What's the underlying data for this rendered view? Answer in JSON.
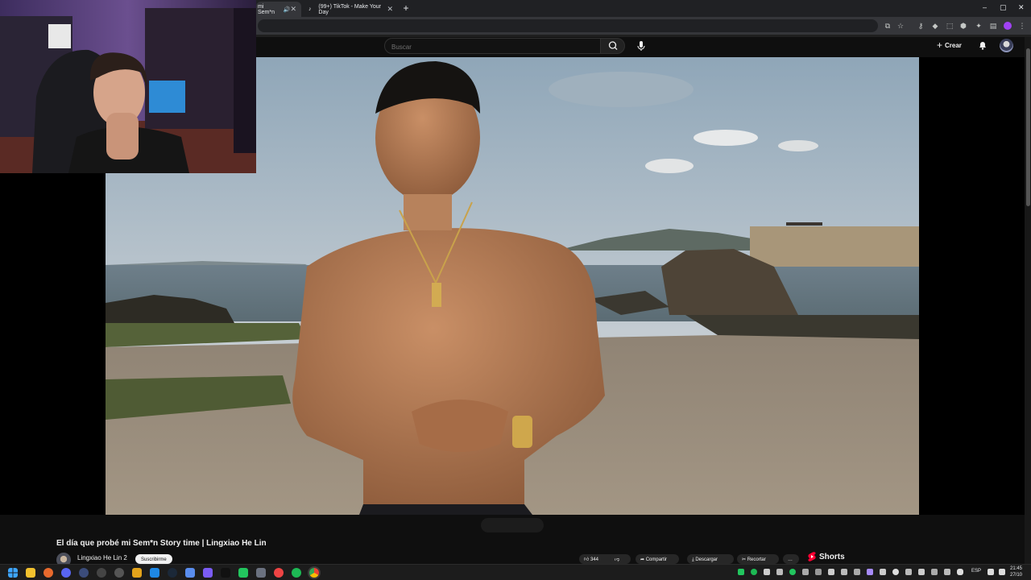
{
  "browser": {
    "tabs": [
      {
        "label": "mi Sem*n",
        "active": true
      },
      {
        "label": "(99+) TikTok - Make Your Day",
        "active": false
      }
    ],
    "new_tab_symbol": "+",
    "window_controls": [
      "–",
      "▢",
      "✕"
    ],
    "accent_extension_color": "#a142f4"
  },
  "youtube": {
    "search": {
      "placeholder": "Buscar",
      "value": ""
    },
    "create_label": "Crear",
    "video": {
      "title": "El día que probé mi Sem*n Story time | Lingxiao He Lin",
      "channel": "Lingxiao He Lin 2",
      "subscribe_label": "Suscribirme"
    },
    "actions": [
      {
        "label": "344",
        "icon": "like-icon"
      },
      {
        "label": "",
        "icon": "dislike-icon"
      },
      {
        "label": "Compartir",
        "icon": "share-icon"
      },
      {
        "label": "Descargar",
        "icon": "download-icon"
      },
      {
        "label": "Recortar",
        "icon": "clip-icon"
      },
      {
        "label": "…",
        "icon": "more-icon"
      }
    ],
    "shorts_label": "Shorts",
    "brand_red": "#ff0033"
  },
  "taskbar": {
    "language": "ESP",
    "time": "21:45",
    "date": "27/10"
  }
}
